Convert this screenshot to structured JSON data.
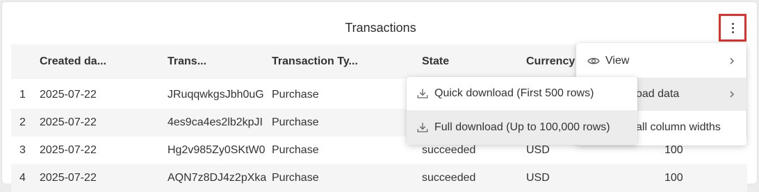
{
  "title": "Transactions",
  "columns": [
    "Created da...",
    "Trans...",
    "Transaction Ty...",
    "State",
    "Currency"
  ],
  "rows": [
    {
      "n": "1",
      "date": "2025-07-22",
      "trans": "JRuqqwkgsJbh0uG",
      "type": "Purchase",
      "state": "",
      "currency": "",
      "amount": ""
    },
    {
      "n": "2",
      "date": "2025-07-22",
      "trans": "4es9ca4es2lb2kpJI",
      "type": "Purchase",
      "state": "",
      "currency": "",
      "amount": ""
    },
    {
      "n": "3",
      "date": "2025-07-22",
      "trans": "Hg2v985Zy0SKtW0",
      "type": "Purchase",
      "state": "succeeded",
      "currency": "USD",
      "amount": "100"
    },
    {
      "n": "4",
      "date": "2025-07-22",
      "trans": "AQN7z8DJ4z2pXka",
      "type": "Purchase",
      "state": "succeeded",
      "currency": "USD",
      "amount": "100"
    }
  ],
  "main_menu": {
    "view_label": "View",
    "download_label": "oad data",
    "widths_label": "all column widths"
  },
  "download_menu": {
    "quick_label": "Quick download (First 500 rows)",
    "full_label": "Full download (Up to 100,000 rows)"
  }
}
